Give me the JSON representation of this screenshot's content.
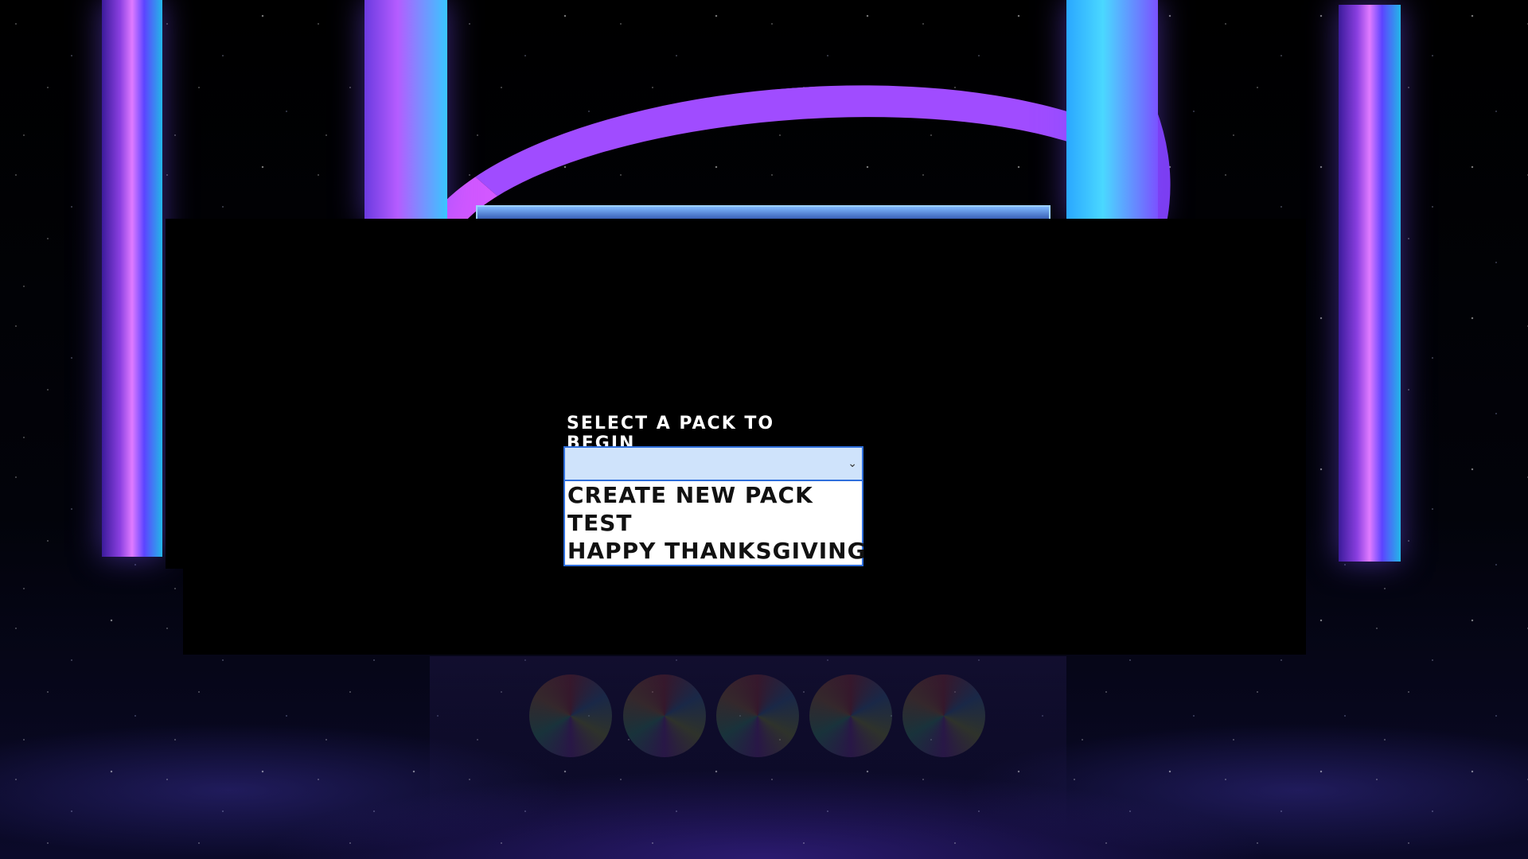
{
  "pack_select": {
    "label": "SELECT A PACK TO BEGIN",
    "selected_value": "",
    "chevron_icon": "chevron-down-icon",
    "options": [
      "CREATE NEW PACK",
      "TEST",
      "HAPPY THANKSGIVING"
    ]
  },
  "theme": {
    "panel_color": "#000000",
    "select_bg": "#cfe3fb",
    "select_border": "#2f6fdc",
    "option_text": "#111111"
  }
}
